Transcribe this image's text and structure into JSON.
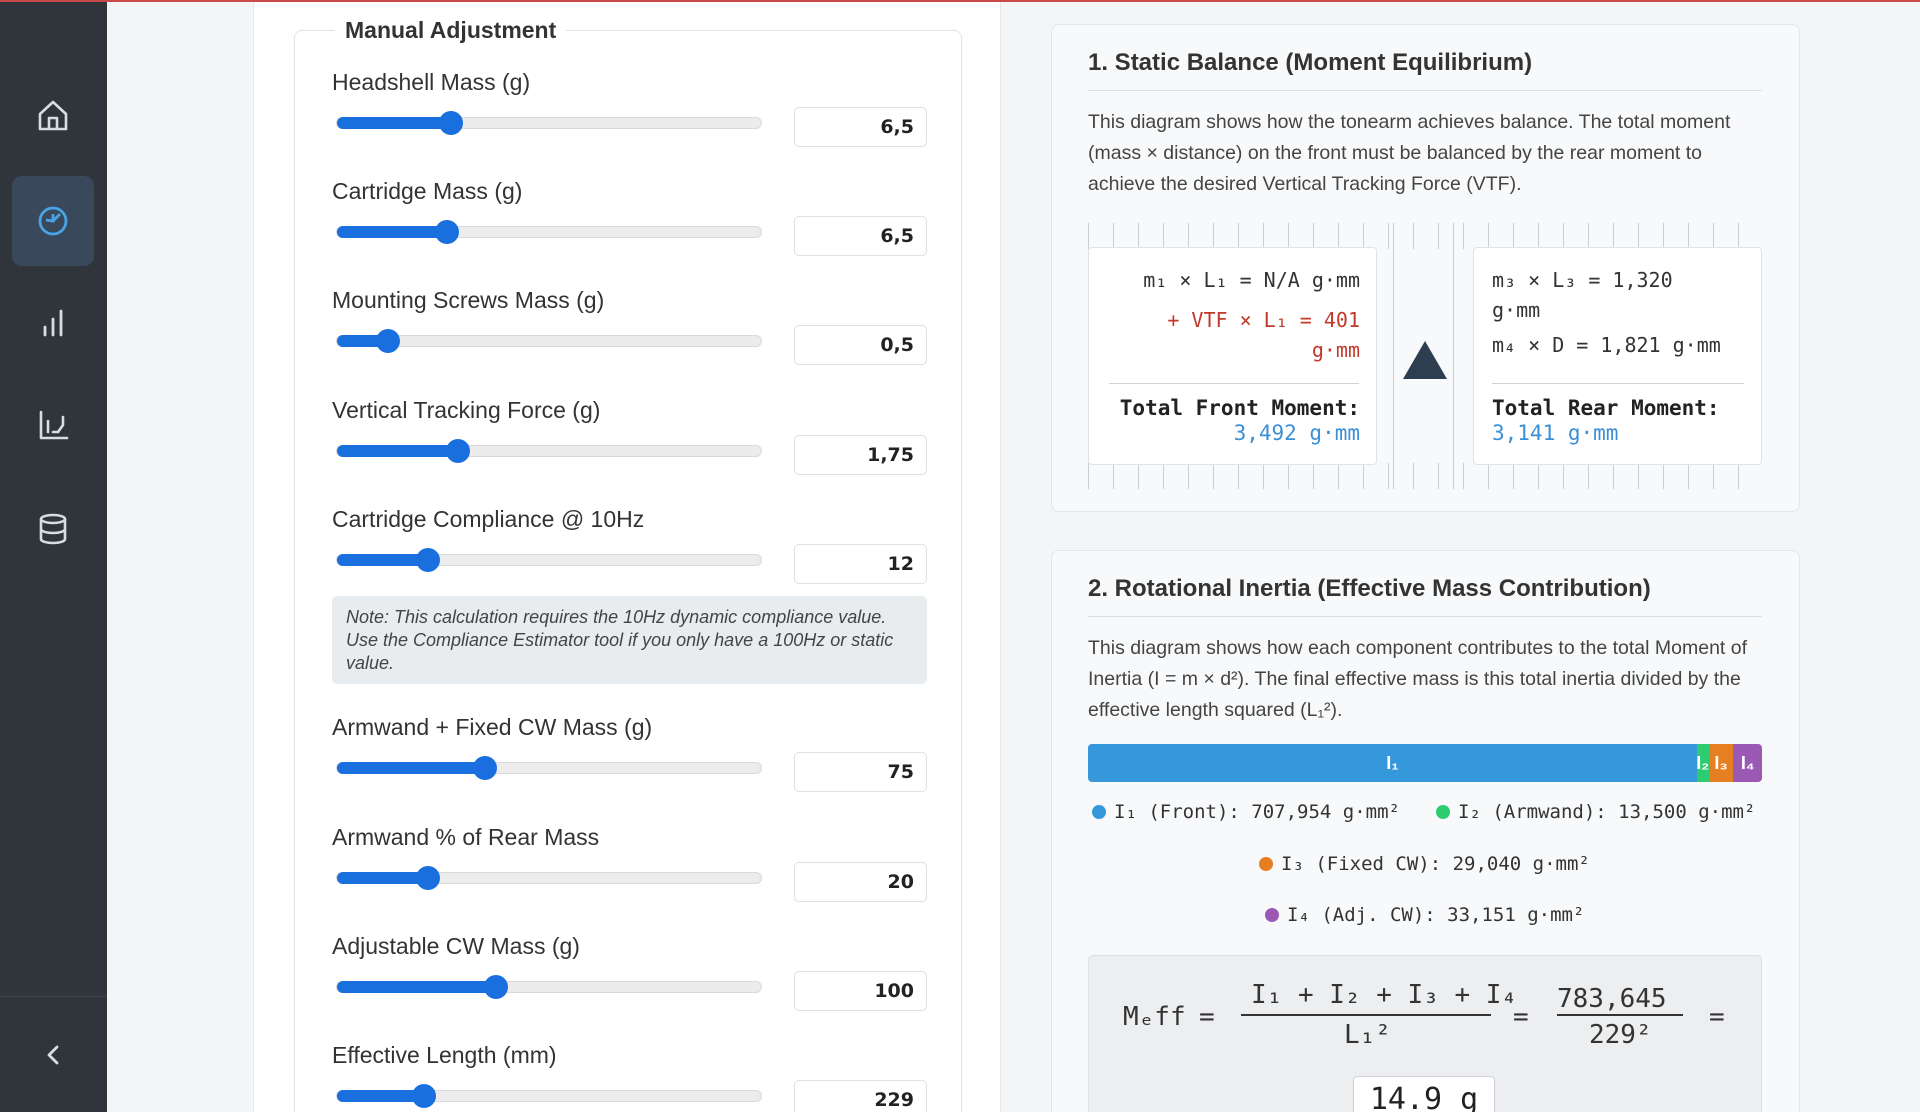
{
  "sidebar": {
    "items": [
      {
        "icon": "home-icon"
      },
      {
        "icon": "gauge-icon",
        "active": true
      },
      {
        "icon": "bar-chart-icon"
      },
      {
        "icon": "line-chart-icon"
      },
      {
        "icon": "database-icon"
      }
    ],
    "collapse_icon": "chevron-left-icon"
  },
  "manual": {
    "legend": "Manual Adjustment",
    "note": "Note: This calculation requires the 10Hz dynamic compliance value. Use the Compliance Estimator tool if you only have a 100Hz or static value.",
    "controls": [
      {
        "label": "Headshell Mass (g)",
        "value": "6,5",
        "fraction": 0.27
      },
      {
        "label": "Cartridge Mass (g)",
        "value": "6,5",
        "fraction": 0.26
      },
      {
        "label": "Mounting Screws Mass (g)",
        "value": "0,5",
        "fraction": 0.12
      },
      {
        "label": "Vertical Tracking Force (g)",
        "value": "1,75",
        "fraction": 0.285
      },
      {
        "label": "Cartridge Compliance @ 10Hz",
        "value": "12",
        "fraction": 0.215
      },
      {
        "label": "Armwand + Fixed CW Mass (g)",
        "value": "75",
        "fraction": 0.35
      },
      {
        "label": "Armwand % of Rear Mass",
        "value": "20",
        "fraction": 0.215
      },
      {
        "label": "Adjustable CW Mass (g)",
        "value": "100",
        "fraction": 0.375
      },
      {
        "label": "Effective Length (mm)",
        "value": "229",
        "fraction": 0.205
      }
    ]
  },
  "balance": {
    "title": "1. Static Balance (Moment Equilibrium)",
    "description": "This diagram shows how the tonearm achieves balance. The total moment (mass × distance) on the front must be balanced by the rear moment to achieve the desired Vertical Tracking Force (VTF).",
    "front_line1": "m₁ × L₁ = N/A g·mm",
    "front_line2": "+ VTF × L₁ = 401",
    "front_line2b": "g·mm",
    "front_total_label": "Total Front Moment:",
    "front_total_value": "3,492 g·mm",
    "rear_line1": "m₃ × L₃ = 1,320",
    "rear_line1b": "g·mm",
    "rear_line2": "m₄ × D = 1,821 g·mm",
    "rear_total_label": "Total Rear Moment:",
    "rear_total_value": "3,141 g·mm"
  },
  "inertia": {
    "title": "2. Rotational Inertia (Effective Mass Contribution)",
    "description": "This diagram shows how each component contributes to the total Moment of Inertia (I = m × d²). The final effective mass is this total inertia divided by the effective length squared (L₁²).",
    "segments": [
      {
        "label": "I₁",
        "color": "#3498db",
        "value": 707954
      },
      {
        "label": "I₂",
        "color": "#2ecc71",
        "value": 13500
      },
      {
        "label": "I₃",
        "color": "#e67e22",
        "value": 29040
      },
      {
        "label": "I₄",
        "color": "#9b59b6",
        "value": 33151
      }
    ],
    "legend": [
      {
        "text": "I₁ (Front): 707,954 g·mm²",
        "color": "#3498db"
      },
      {
        "text": "I₂ (Armwand): 13,500 g·mm²",
        "color": "#2ecc71"
      },
      {
        "text": "I₃ (Fixed CW): 29,040 g·mm²",
        "color": "#e67e22"
      },
      {
        "text": "I₄ (Adj. CW): 33,151 g·mm²",
        "color": "#9b59b6"
      }
    ],
    "formula": {
      "lhs": "Mₑff",
      "eq": "=",
      "num": "I₁ + I₂ + I₃ + I₄",
      "den": "L₁²",
      "num2": "783,645",
      "den2": "229²",
      "result": "14.9 g"
    }
  }
}
